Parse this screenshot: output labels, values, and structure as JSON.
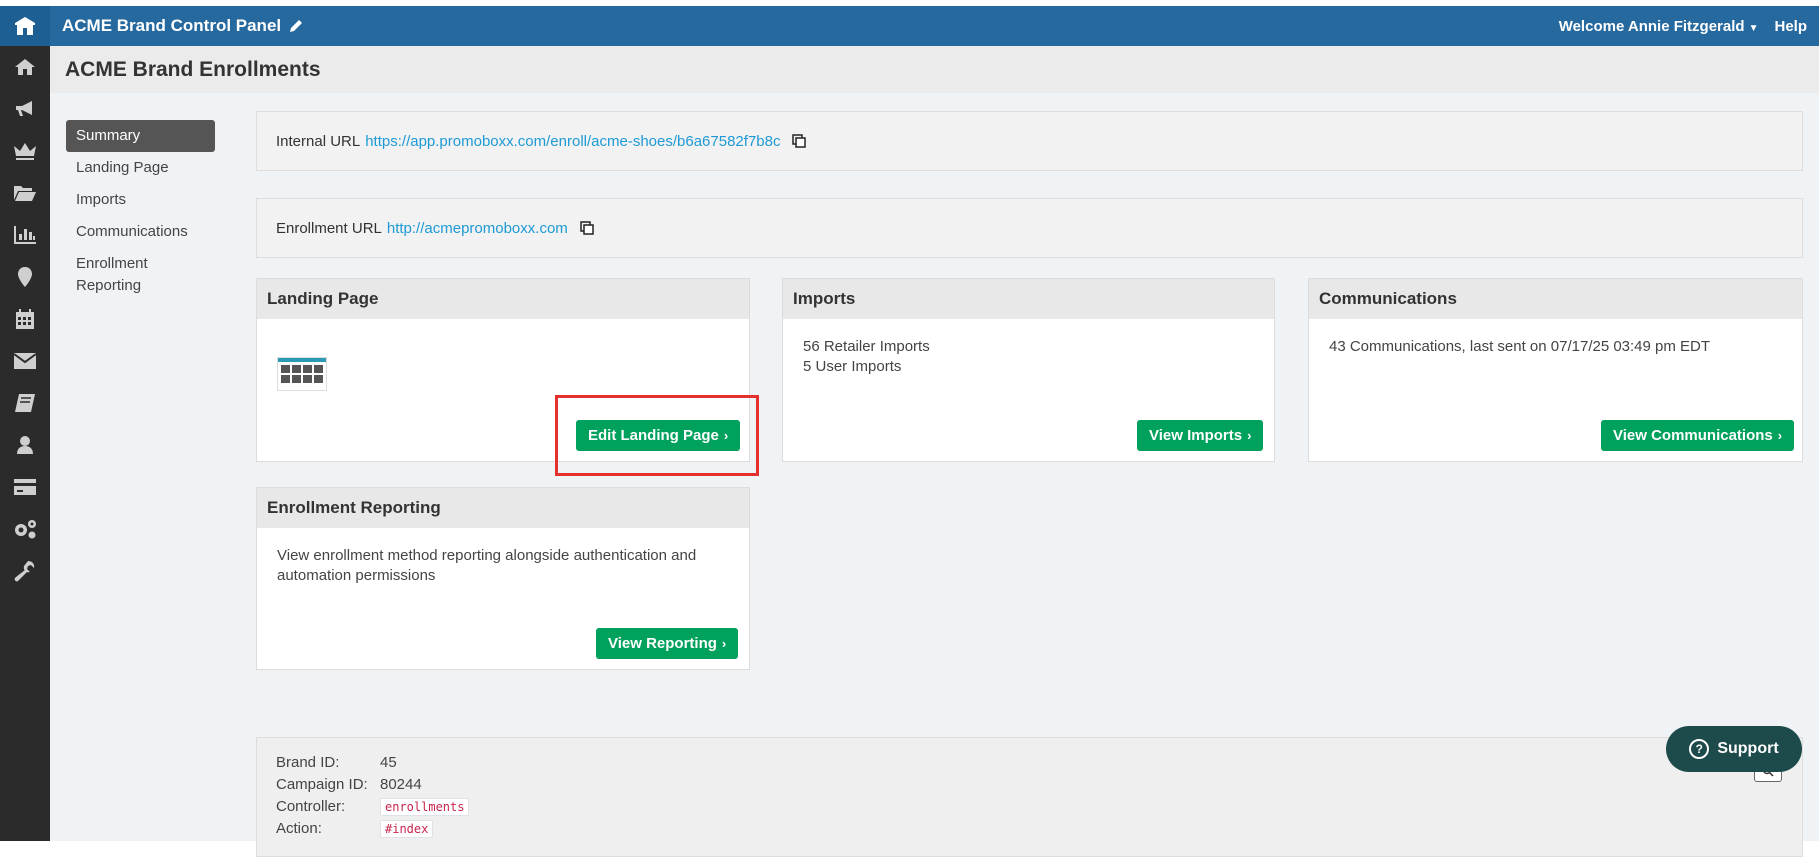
{
  "topbar": {
    "app_title": "ACME Brand Control Panel",
    "welcome": "Welcome Annie Fitzgerald",
    "help": "Help"
  },
  "page": {
    "title": "ACME Brand Enrollments"
  },
  "subnav": {
    "items": [
      "Summary",
      "Landing Page",
      "Imports",
      "Communications",
      "Enrollment Reporting"
    ]
  },
  "urls": {
    "internal_label": "Internal URL",
    "internal_value": "https://app.promoboxx.com/enroll/acme-shoes/b6a67582f7b8c",
    "enrollment_label": "Enrollment URL",
    "enrollment_value": "http://acmepromoboxx.com"
  },
  "cards": {
    "landing": {
      "title": "Landing Page",
      "button": "Edit Landing Page"
    },
    "imports": {
      "title": "Imports",
      "line1": "56 Retailer Imports",
      "line2": "5 User Imports",
      "button": "View Imports"
    },
    "communications": {
      "title": "Communications",
      "text": "43 Communications, last sent on 07/17/25 03:49 pm EDT",
      "button": "View Communications"
    },
    "reporting": {
      "title": "Enrollment Reporting",
      "text": "View enrollment method reporting alongside authentication and automation permissions",
      "button": "View Reporting"
    }
  },
  "info": {
    "brand_id_label": "Brand ID:",
    "brand_id": "45",
    "campaign_id_label": "Campaign ID:",
    "campaign_id": "80244",
    "controller_label": "Controller:",
    "controller": "enrollments",
    "action_label": "Action:",
    "action": "#index"
  },
  "support": {
    "label": "Support"
  },
  "colors": {
    "topbar": "#26699f",
    "sidebar": "#2b2b2b",
    "accent_button": "#00a15c",
    "link": "#1d9ad6",
    "highlight": "#e53030"
  },
  "icons": {
    "sidebar": [
      "home-icon",
      "megaphone-icon",
      "crown-icon",
      "folder-open-icon",
      "bar-chart-icon",
      "map-pin-icon",
      "calendar-icon",
      "envelope-icon",
      "book-icon",
      "user-icon",
      "credit-card-icon",
      "gears-icon",
      "wrench-icon"
    ]
  }
}
